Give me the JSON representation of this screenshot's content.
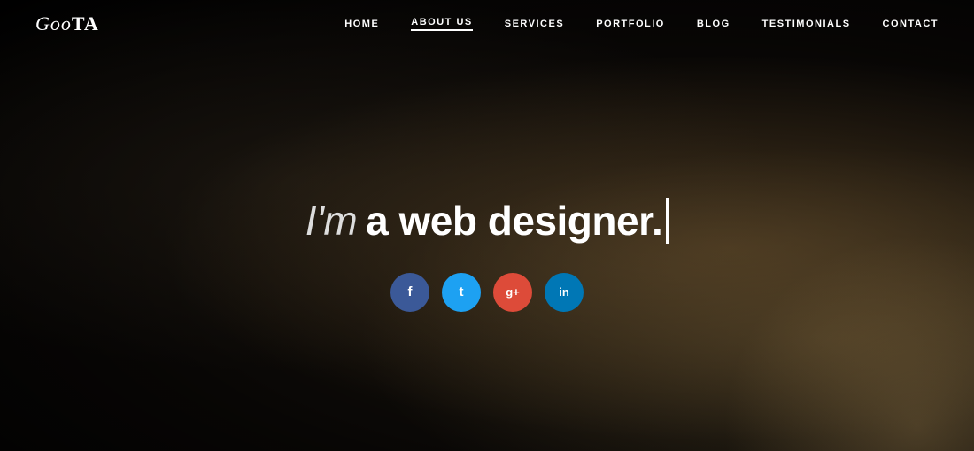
{
  "site": {
    "logo": "GooTA",
    "logo_goo": "Goo",
    "logo_ta": "TA"
  },
  "nav": {
    "items": [
      {
        "label": "HOME",
        "id": "home",
        "active": false
      },
      {
        "label": "ABOUT US",
        "id": "about-us",
        "active": true
      },
      {
        "label": "SERVICES",
        "id": "services",
        "active": false
      },
      {
        "label": "PORTFOLIO",
        "id": "portfolio",
        "active": false
      },
      {
        "label": "BLOG",
        "id": "blog",
        "active": false
      },
      {
        "label": "TESTIMONIALS",
        "id": "testimonials",
        "active": false
      },
      {
        "label": "CONTACT",
        "id": "contact",
        "active": false
      }
    ]
  },
  "hero": {
    "headline_light": "I'm",
    "headline_bold": "a web designer.",
    "cursor_visible": true
  },
  "social": {
    "items": [
      {
        "id": "facebook",
        "label": "f",
        "title": "Facebook",
        "color_class": "facebook"
      },
      {
        "id": "twitter",
        "label": "t",
        "title": "Twitter",
        "color_class": "twitter"
      },
      {
        "id": "google",
        "label": "g+",
        "title": "Google Plus",
        "color_class": "google"
      },
      {
        "id": "linkedin",
        "label": "in",
        "title": "LinkedIn",
        "color_class": "linkedin"
      }
    ]
  },
  "colors": {
    "facebook": "#3b5998",
    "twitter": "#1da1f2",
    "google": "#dd4b39",
    "linkedin": "#0077b5",
    "background": "#111",
    "text_primary": "#ffffff"
  }
}
